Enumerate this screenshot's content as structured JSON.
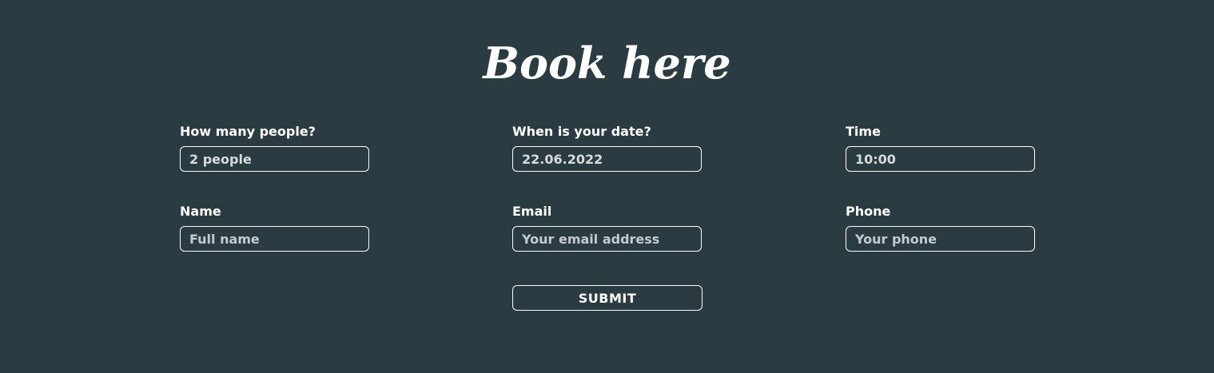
{
  "header": {
    "title": "Book here"
  },
  "form": {
    "people": {
      "label": "How many people?",
      "value": "2 people",
      "placeholder": ""
    },
    "date": {
      "label": "When is your date?",
      "value": "22.06.2022",
      "placeholder": ""
    },
    "time": {
      "label": "Time",
      "value": "10:00",
      "placeholder": ""
    },
    "name": {
      "label": "Name",
      "value": "",
      "placeholder": "Full name"
    },
    "email": {
      "label": "Email",
      "value": "",
      "placeholder": "Your email address"
    },
    "phone": {
      "label": "Phone",
      "value": "",
      "placeholder": "Your phone"
    },
    "submit_label": "SUBMIT"
  },
  "colors": {
    "background": "#2b3b42",
    "text": "#ffffff",
    "border": "#ffffff"
  }
}
